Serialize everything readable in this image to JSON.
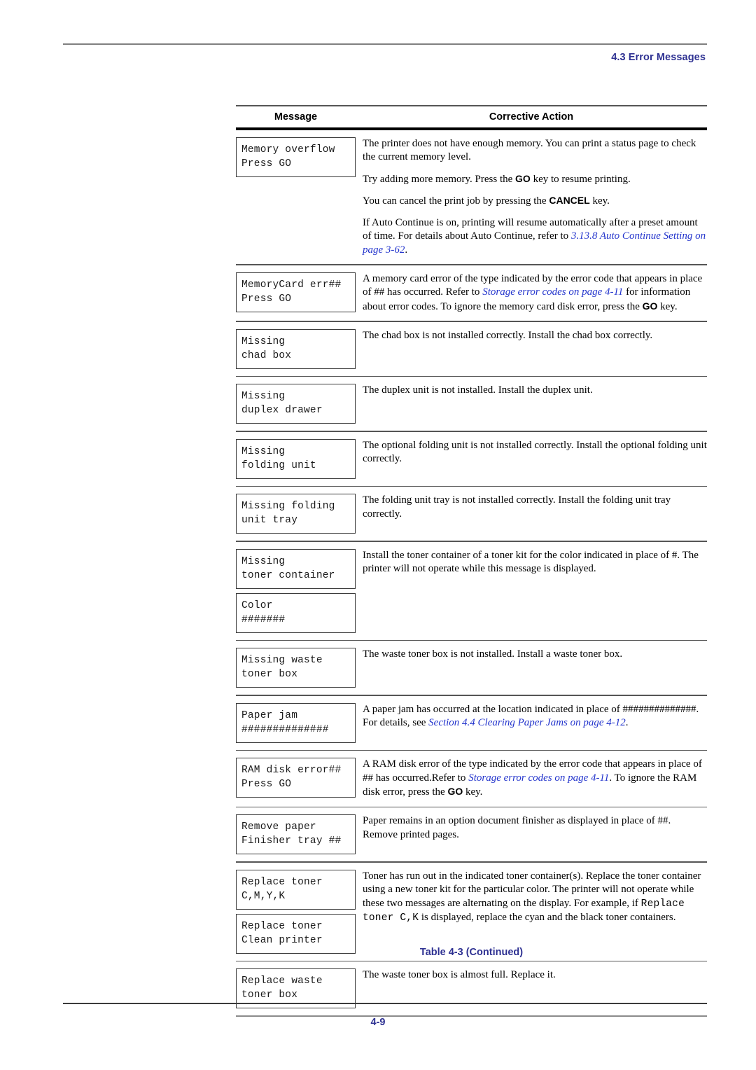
{
  "header": {
    "section_title": "4.3 Error Messages"
  },
  "table": {
    "columns": {
      "message": "Message",
      "action": "Corrective Action"
    },
    "caption": "Table 4-3  (Continued)",
    "rows": [
      {
        "boxes": [
          {
            "lines": [
              "Memory overflow",
              "Press GO"
            ]
          }
        ],
        "paragraphs": [
          {
            "parts": [
              {
                "t": "The printer does not have enough memory. You can print a status page to check the current memory level.",
                "s": "n"
              }
            ]
          },
          {
            "parts": [
              {
                "t": "Try adding more memory. Press the ",
                "s": "n"
              },
              {
                "t": "GO",
                "s": "kb"
              },
              {
                "t": " key to resume printing.",
                "s": "n"
              }
            ]
          },
          {
            "parts": [
              {
                "t": "You can cancel the print job by pressing the ",
                "s": "n"
              },
              {
                "t": "CANCEL",
                "s": "kb"
              },
              {
                "t": " key.",
                "s": "n"
              }
            ]
          },
          {
            "parts": [
              {
                "t": "If Auto Continue is on, printing will resume automatically after a preset amount of time. For details about Auto Continue, refer to ",
                "s": "n"
              },
              {
                "t": "3.13.8 Auto Continue Setting on page 3-62",
                "s": "x"
              },
              {
                "t": ".",
                "s": "n"
              }
            ]
          }
        ]
      },
      {
        "boxes": [
          {
            "lines": [
              "MemoryCard err##",
              "Press GO"
            ]
          }
        ],
        "paragraphs": [
          {
            "parts": [
              {
                "t": "A memory card error of the type indicated by the error code that appears in place of ## has occurred. Refer to ",
                "s": "n"
              },
              {
                "t": "Storage error codes on page 4-11",
                "s": "x"
              },
              {
                "t": " for information about error codes. To ignore the memory card disk error, press the ",
                "s": "n"
              },
              {
                "t": "GO",
                "s": "kb"
              },
              {
                "t": " key.",
                "s": "n"
              }
            ]
          }
        ]
      },
      {
        "boxes": [
          {
            "lines": [
              "Missing",
              "chad box"
            ]
          }
        ],
        "paragraphs": [
          {
            "parts": [
              {
                "t": "The chad box is not installed correctly. Install the chad box correctly.",
                "s": "n"
              }
            ]
          }
        ]
      },
      {
        "boxes": [
          {
            "lines": [
              "Missing",
              "duplex drawer"
            ]
          }
        ],
        "paragraphs": [
          {
            "parts": [
              {
                "t": "The duplex unit is not installed. Install the duplex unit.",
                "s": "n"
              }
            ]
          }
        ]
      },
      {
        "boxes": [
          {
            "lines": [
              "Missing",
              "folding unit"
            ]
          }
        ],
        "paragraphs": [
          {
            "parts": [
              {
                "t": "The optional folding unit is not installed correctly. Install the optional folding unit correctly.",
                "s": "n"
              }
            ]
          }
        ]
      },
      {
        "boxes": [
          {
            "lines": [
              "Missing folding",
              "unit tray"
            ]
          }
        ],
        "paragraphs": [
          {
            "parts": [
              {
                "t": "The folding unit tray is not installed correctly. Install the folding unit tray correctly.",
                "s": "n"
              }
            ]
          }
        ]
      },
      {
        "boxes": [
          {
            "lines": [
              "Missing",
              "toner container"
            ]
          },
          {
            "lines": [
              "Color",
              "#######"
            ]
          }
        ],
        "paragraphs": [
          {
            "parts": [
              {
                "t": "Install the toner container of a toner kit for the color indicated in place of #. The printer will not operate while this message is displayed.",
                "s": "n"
              }
            ]
          }
        ]
      },
      {
        "boxes": [
          {
            "lines": [
              "Missing waste",
              "toner box"
            ]
          }
        ],
        "paragraphs": [
          {
            "parts": [
              {
                "t": "The waste toner box is not installed. Install a waste toner box.",
                "s": "n"
              }
            ]
          }
        ]
      },
      {
        "boxes": [
          {
            "lines": [
              "Paper jam",
              "##############"
            ]
          }
        ],
        "paragraphs": [
          {
            "parts": [
              {
                "t": " A paper jam has occurred at the location indicated in place of ##############. For details, see ",
                "s": "n"
              },
              {
                "t": "Section 4.4 Clearing Paper Jams on page 4-12",
                "s": "x"
              },
              {
                "t": ".",
                "s": "n"
              }
            ]
          }
        ]
      },
      {
        "boxes": [
          {
            "lines": [
              "RAM disk error##",
              "Press GO"
            ]
          }
        ],
        "paragraphs": [
          {
            "parts": [
              {
                "t": "A RAM disk error of the type indicated by the error code that appears in place of ## has occurred.Refer to ",
                "s": "n"
              },
              {
                "t": "Storage error codes on page 4-11",
                "s": "x"
              },
              {
                "t": ". To ignore the RAM disk error, press the ",
                "s": "n"
              },
              {
                "t": "GO",
                "s": "kb"
              },
              {
                "t": " key.",
                "s": "n"
              }
            ]
          }
        ]
      },
      {
        "boxes": [
          {
            "lines": [
              "Remove paper",
              "Finisher tray ##"
            ]
          }
        ],
        "paragraphs": [
          {
            "parts": [
              {
                "t": "Paper remains in an option document finisher as displayed in place of ##. Remove printed pages.",
                "s": "n"
              }
            ]
          }
        ]
      },
      {
        "boxes": [
          {
            "lines": [
              "Replace toner",
              "C,M,Y,K"
            ]
          },
          {
            "lines": [
              "Replace toner",
              "Clean printer"
            ]
          }
        ],
        "paragraphs": [
          {
            "parts": [
              {
                "t": "Toner has run out in the indicated toner container(s). Replace the toner container using a new toner kit for the particular color. The printer will not operate while these two messages are alternating on the display. For example, if ",
                "s": "n"
              },
              {
                "t": "Replace toner C,K",
                "s": "m"
              },
              {
                "t": " is displayed, replace the cyan and the black toner containers.",
                "s": "n"
              }
            ]
          }
        ]
      },
      {
        "boxes": [
          {
            "lines": [
              "Replace waste",
              "toner box"
            ]
          }
        ],
        "paragraphs": [
          {
            "parts": [
              {
                "t": "The waste toner box is almost full. Replace it.",
                "s": "n"
              }
            ]
          }
        ]
      }
    ]
  },
  "footer": {
    "page_number": "4-9"
  },
  "colors": {
    "heading_navy": "#2e3192",
    "xref_blue": "#2233cc",
    "rule_gray": "#808080",
    "rule_dark": "#3a3a3a"
  }
}
